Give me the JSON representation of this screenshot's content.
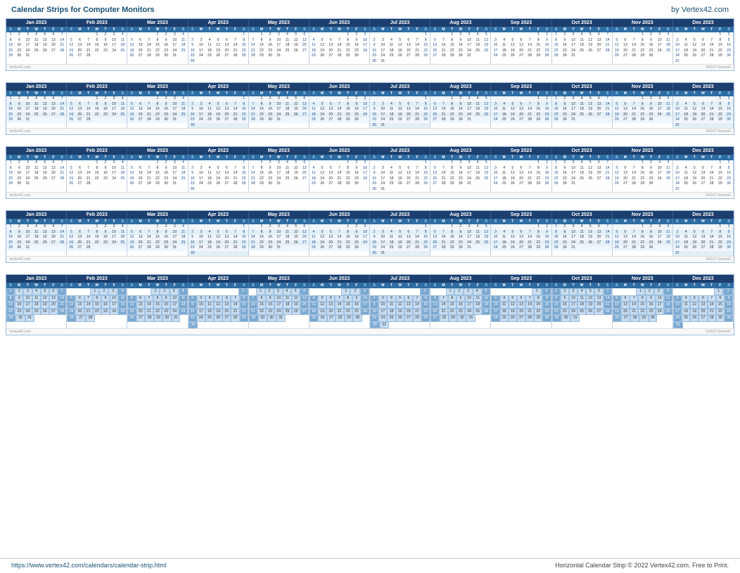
{
  "header": {
    "title": "Calendar Strips for Computer Monitors",
    "credit": "by Vertex42.com"
  },
  "footer": {
    "url": "https://www.vertex42.com/calendars/calendar-strip.html",
    "copyright": "Horizontal Calendar Strip © 2022 Vertex42.com. Free to Print."
  },
  "months": [
    "Jan 2023",
    "Feb 2023",
    "Mar 2023",
    "Apr 2023",
    "May 2023",
    "Jun 2023",
    "Jul 2023",
    "Aug 2023",
    "Sep 2023",
    "Oct 2023",
    "Nov 2023",
    "Dec 2023"
  ],
  "dow": [
    "S",
    "M",
    "T",
    "W",
    "T",
    "F",
    "S"
  ],
  "watermark": "Vertex42.com",
  "copyright_note": "©2022 Vertex42"
}
